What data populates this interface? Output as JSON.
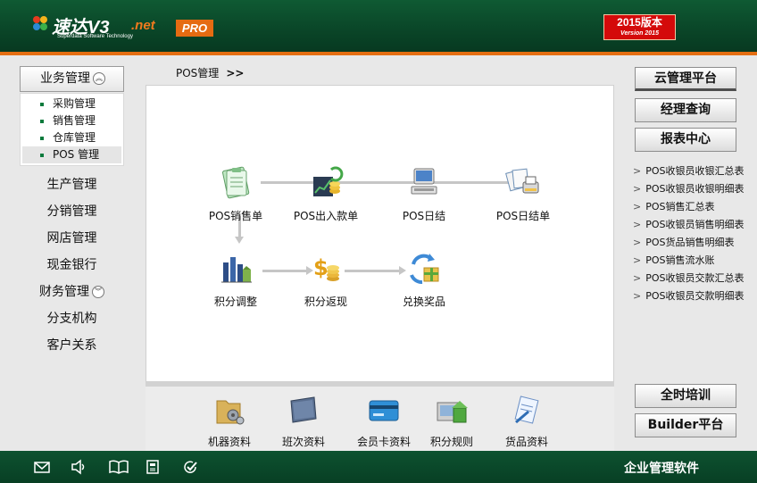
{
  "header": {
    "brand_name": "速达V3",
    "brand_suffix": ".net",
    "brand_subtitle": "Superdata Software Technology",
    "edition_badge": "PRO",
    "version_main": "2015版本",
    "version_sub": "Version 2015"
  },
  "sidebar": {
    "expanded_section": "业务管理",
    "sub_items": [
      "采购管理",
      "销售管理",
      "仓库管理",
      "POS 管理"
    ],
    "active_sub_item": "POS 管理",
    "items": [
      "生产管理",
      "分销管理",
      "网店管理",
      "现金银行",
      "财务管理",
      "分支机构",
      "客户关系"
    ]
  },
  "breadcrumb": {
    "text": "POS管理",
    "separator": ">>"
  },
  "flow": {
    "nodes": [
      {
        "label": "POS销售单",
        "icon": "clipboard-icon"
      },
      {
        "label": "POS出入款单",
        "icon": "cash-chart-icon"
      },
      {
        "label": "POS日结",
        "icon": "computer-icon"
      },
      {
        "label": "POS日结单",
        "icon": "documents-printer-icon"
      },
      {
        "label": "积分调整",
        "icon": "factory-chart-icon"
      },
      {
        "label": "积分返现",
        "icon": "coin-icon"
      },
      {
        "label": "兑换奖品",
        "icon": "gift-exchange-icon"
      }
    ]
  },
  "tools": [
    {
      "label": "机器资料",
      "icon": "folder-gears-icon"
    },
    {
      "label": "班次资料",
      "icon": "slate-icon"
    },
    {
      "label": "会员卡资料",
      "icon": "member-card-icon"
    },
    {
      "label": "积分规则",
      "icon": "points-rule-icon"
    },
    {
      "label": "货品资料",
      "icon": "goods-tag-icon"
    }
  ],
  "right_panel": {
    "buttons": [
      "云管理平台",
      "经理查询",
      "报表中心"
    ],
    "reports": [
      "POS收银员收银汇总表",
      "POS收银员收银明细表",
      "POS销售汇总表",
      "POS收银员销售明细表",
      "POS货品销售明细表",
      "POS销售流水账",
      "POS收银员交款汇总表",
      "POS收银员交款明细表"
    ],
    "bottom_buttons": [
      "全时培训",
      "Builder平台"
    ]
  },
  "footer": {
    "title": "企业管理软件",
    "icons": [
      "mail-icon",
      "speaker-icon",
      "book-icon",
      "news-icon",
      "check-icon"
    ]
  },
  "colors": {
    "header_green": "#0a4628",
    "accent_orange": "#e46e12",
    "version_red": "#d40a0a",
    "footer_green": "#0b4a2b"
  }
}
